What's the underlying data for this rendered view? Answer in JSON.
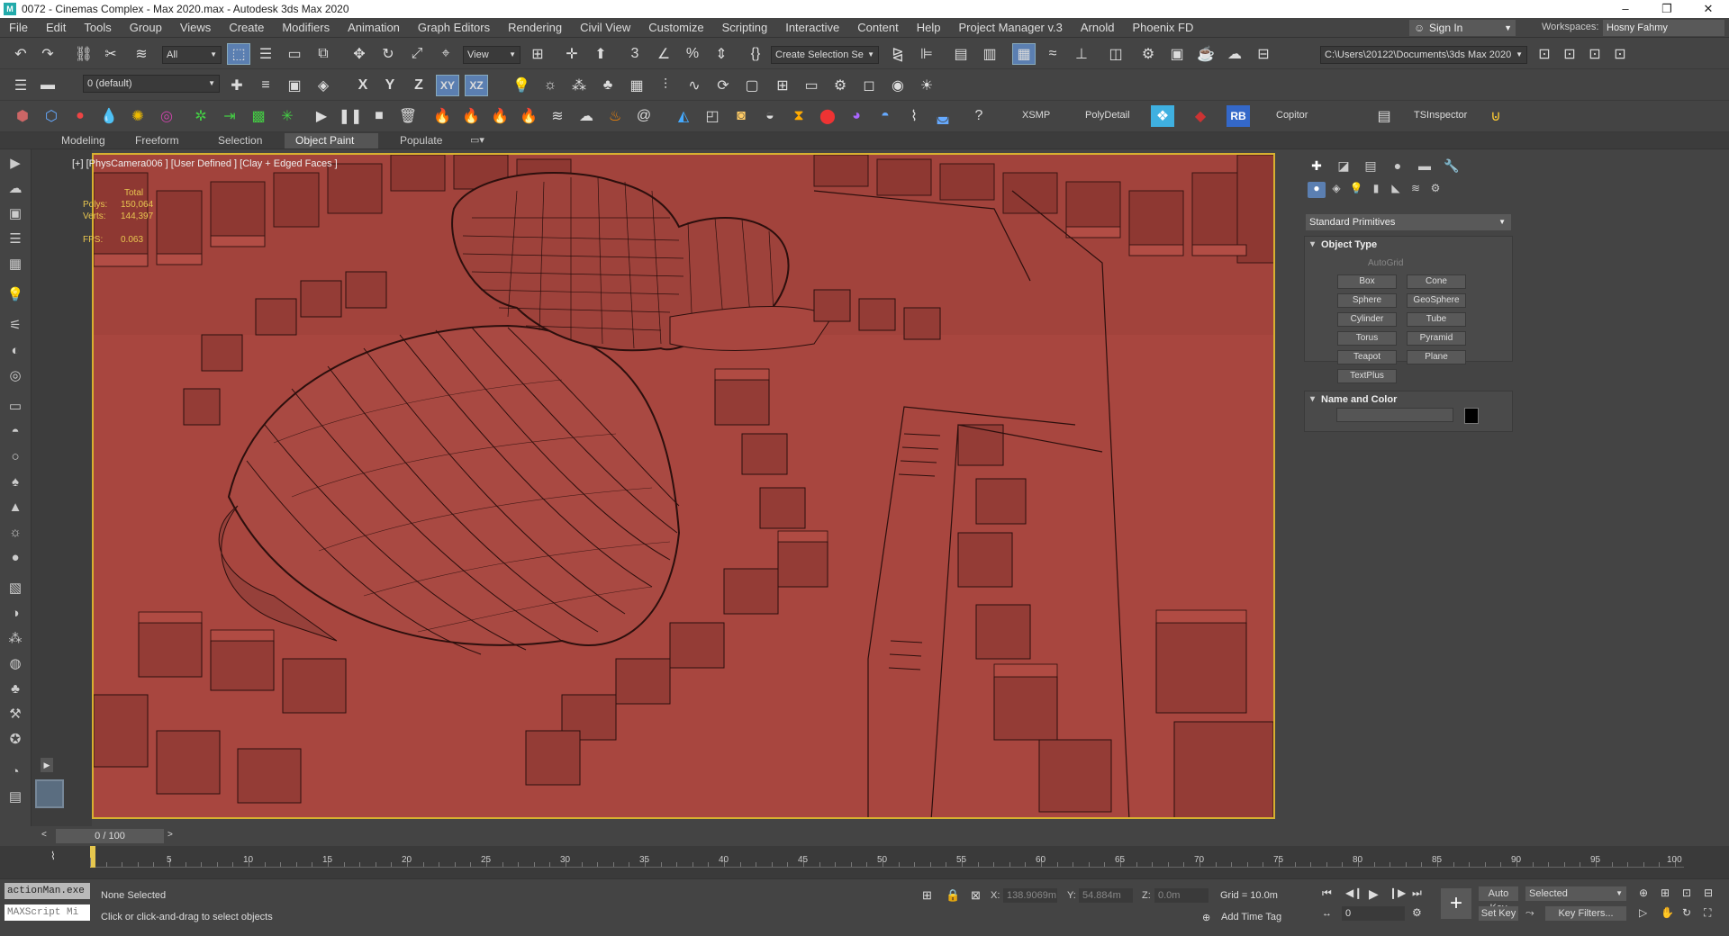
{
  "window": {
    "title": "0072 - Cinemas Complex - Max 2020.max - Autodesk 3ds Max 2020",
    "controls": [
      "–",
      "❐",
      "✕"
    ]
  },
  "menu": {
    "items": [
      "File",
      "Edit",
      "Tools",
      "Group",
      "Views",
      "Create",
      "Modifiers",
      "Animation",
      "Graph Editors",
      "Rendering",
      "Civil View",
      "Customize",
      "Scripting",
      "Interactive",
      "Content",
      "Help",
      "Project Manager v.3",
      "Arnold",
      "Phoenix FD"
    ],
    "sign_in": "Sign In",
    "workspaces_label": "Workspaces:",
    "workspace_value": "Hosny Fahmy"
  },
  "toolbar1": {
    "selection_filter": "All",
    "ref_coord": "View",
    "named_selection": "Create Selection Se",
    "project_path": "C:\\Users\\20122\\Documents\\3ds Max 2020"
  },
  "toolbar2": {
    "layer": "0 (default)",
    "axis_x": "X",
    "axis_y": "Y",
    "axis_z": "Z",
    "axis_xy": "XY",
    "axis_xz": "XZ"
  },
  "toolbar3": {
    "xsmp": "XSMP",
    "polydetail": "PolyDetail",
    "rb": "RB",
    "copitor": "Copitor",
    "tsinspector": "TSInspector"
  },
  "ribbon": {
    "tabs": [
      "Modeling",
      "Freeform",
      "Selection",
      "Object Paint",
      "Populate"
    ],
    "active": "Object Paint"
  },
  "viewport": {
    "label": "[+] [PhysCamera006 ] [User Defined ] [Clay + Edged Faces ]",
    "stats": {
      "total_label": "Total",
      "polys_label": "Polys:",
      "polys": "150,064",
      "verts_label": "Verts:",
      "verts": "144,397",
      "fps_label": "FPS:",
      "fps": "0.063"
    },
    "clay_color": "#a8463f",
    "border_color": "#d7b030"
  },
  "command_panel": {
    "category": "Standard Primitives",
    "object_type_title": "Object Type",
    "autogrid": "AutoGrid",
    "objects": [
      "Box",
      "Cone",
      "Sphere",
      "GeoSphere",
      "Cylinder",
      "Tube",
      "Torus",
      "Pyramid",
      "Teapot",
      "Plane",
      "TextPlus"
    ],
    "name_color_title": "Name and Color"
  },
  "timeline": {
    "frame_display": "0 / 100",
    "ticks": [
      "5",
      "10",
      "15",
      "20",
      "25",
      "30",
      "35",
      "40",
      "45",
      "50",
      "55",
      "60",
      "65",
      "70",
      "75",
      "80",
      "85",
      "90",
      "95",
      "100"
    ]
  },
  "status": {
    "maxscript_1": "actionMan.exe",
    "maxscript_2": "MAXScript Mi",
    "selection": "None Selected",
    "prompt": "Click or click-and-drag to select objects",
    "x_label": "X:",
    "x_value": "138.9069m",
    "y_label": "Y:",
    "y_value": "54.884m",
    "z_label": "Z:",
    "z_value": "0.0m",
    "grid": "Grid = 10.0m",
    "add_time_tag": "Add Time Tag",
    "auto_key": "Auto Key",
    "set_key": "Set Key",
    "key_mode": "Selected",
    "key_filters": "Key Filters...",
    "current_frame": "0"
  }
}
